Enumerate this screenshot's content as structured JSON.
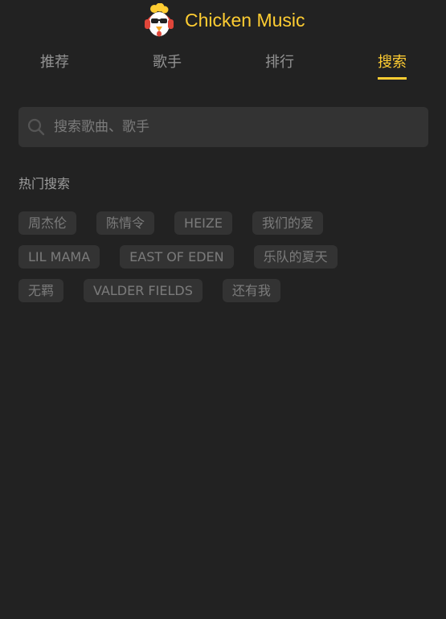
{
  "app": {
    "title": "Chicken Music",
    "logo_icon": "chicken-logo-icon"
  },
  "colors": {
    "background": "#222222",
    "accent": "#ffcd32",
    "panel": "#333333"
  },
  "tabs": [
    {
      "label": "推荐",
      "active": false
    },
    {
      "label": "歌手",
      "active": false
    },
    {
      "label": "排行",
      "active": false
    },
    {
      "label": "搜索",
      "active": true
    }
  ],
  "search": {
    "icon": "search-icon",
    "placeholder": "搜索歌曲、歌手",
    "value": ""
  },
  "hot_search": {
    "title": "热门搜索",
    "keys": [
      "周杰伦",
      "陈情令",
      "HEIZE",
      "我们的爱",
      "LIL MAMA",
      "EAST OF EDEN",
      "乐队的夏天",
      "无羁",
      "VALDER FIELDS",
      "还有我"
    ]
  }
}
